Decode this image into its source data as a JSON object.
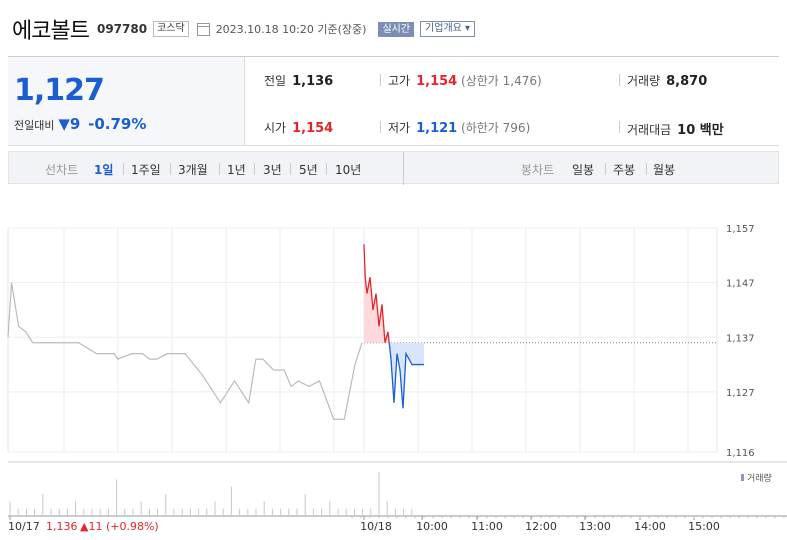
{
  "header": {
    "name": "에코볼트",
    "code": "097780",
    "market": "코스닥",
    "datetime": "2023.10.18 10:20 기준(장중)",
    "realtime_label": "실시간",
    "company_info_label": "기업개요 ▾"
  },
  "quote": {
    "price": "1,127",
    "change_label": "전일대비",
    "change_arrow": "▼",
    "change": "9",
    "change_pct": "-0.79%",
    "prev_label": "전일",
    "prev": "1,136",
    "high_label": "고가",
    "high": "1,154",
    "upper_limit": "(상한가 1,476)",
    "volume_label": "거래량",
    "volume": "8,870",
    "open_label": "시가",
    "open": "1,154",
    "low_label": "저가",
    "low": "1,121",
    "lower_limit": "(하한가 796)",
    "amount_label": "거래대금",
    "amount": "10 백만"
  },
  "tabs": {
    "line_label": "선차트",
    "periods": [
      "1일",
      "1주일",
      "3개월",
      "1년",
      "3년",
      "5년",
      "10년"
    ],
    "selected": "1일",
    "candle_label": "봉차트",
    "candles": [
      "일봉",
      "주봉",
      "월봉"
    ]
  },
  "chart_data": {
    "type": "line",
    "y_ticks": [
      "1,157",
      "1,147",
      "1,137",
      "1,127",
      "1,116"
    ],
    "ylim": [
      1116,
      1157
    ],
    "reference_price": 1136,
    "volume_label": "거래량",
    "x_labels": {
      "prev_day": "10/17",
      "prev_close_text": "1,136",
      "prev_change_text": "▲11 (+0.98%)",
      "today": "10/18",
      "hours": [
        "10:00",
        "11:00",
        "12:00",
        "13:00",
        "14:00",
        "15:00"
      ]
    },
    "series": [
      {
        "day": "10/17",
        "x": [
          0,
          0.01,
          0.03,
          0.05,
          0.07,
          0.08,
          0.09,
          0.1,
          0.12,
          0.15,
          0.2,
          0.25,
          0.28,
          0.3,
          0.31,
          0.35,
          0.38,
          0.4,
          0.42,
          0.45,
          0.5,
          0.55,
          0.6,
          0.64,
          0.68,
          0.7,
          0.72,
          0.75,
          0.78,
          0.8,
          0.82,
          0.85,
          0.88,
          0.92,
          0.95,
          0.98,
          1.0
        ],
        "y": [
          1137,
          1147,
          1139,
          1138,
          1136,
          1136,
          1136,
          1136,
          1136,
          1136,
          1136,
          1134,
          1134,
          1134,
          1133,
          1134,
          1134,
          1133,
          1133,
          1134,
          1134,
          1130,
          1125,
          1129,
          1125,
          1133,
          1133,
          1131,
          1131,
          1128,
          1129,
          1128,
          1129,
          1122,
          1122,
          1132,
          1136
        ]
      },
      {
        "day": "10/18",
        "x": [
          0,
          0.02,
          0.05,
          0.1,
          0.15,
          0.2,
          0.25,
          0.3,
          0.35,
          0.4,
          0.45,
          0.5,
          0.55,
          0.6,
          0.65,
          0.7,
          0.75,
          0.8,
          0.85,
          0.9,
          0.95,
          1.0
        ],
        "y": [
          1154,
          1148,
          1145,
          1148,
          1142,
          1145,
          1139,
          1143,
          1136,
          1138,
          1133,
          1125,
          1134,
          1131,
          1124,
          1134,
          1133,
          1132,
          1132,
          1132,
          1132,
          1132
        ]
      }
    ],
    "volume": [
      2,
      1,
      1,
      1,
      3,
      1,
      1,
      1,
      2,
      1,
      1,
      1,
      1,
      5,
      1,
      1,
      2,
      1,
      1,
      3,
      1,
      1,
      1,
      1,
      1,
      2,
      1,
      4,
      1,
      1,
      1,
      2,
      1,
      1,
      1,
      1,
      3,
      1,
      1,
      2,
      1,
      1,
      1,
      1,
      1,
      6,
      2,
      1,
      1,
      1
    ]
  }
}
